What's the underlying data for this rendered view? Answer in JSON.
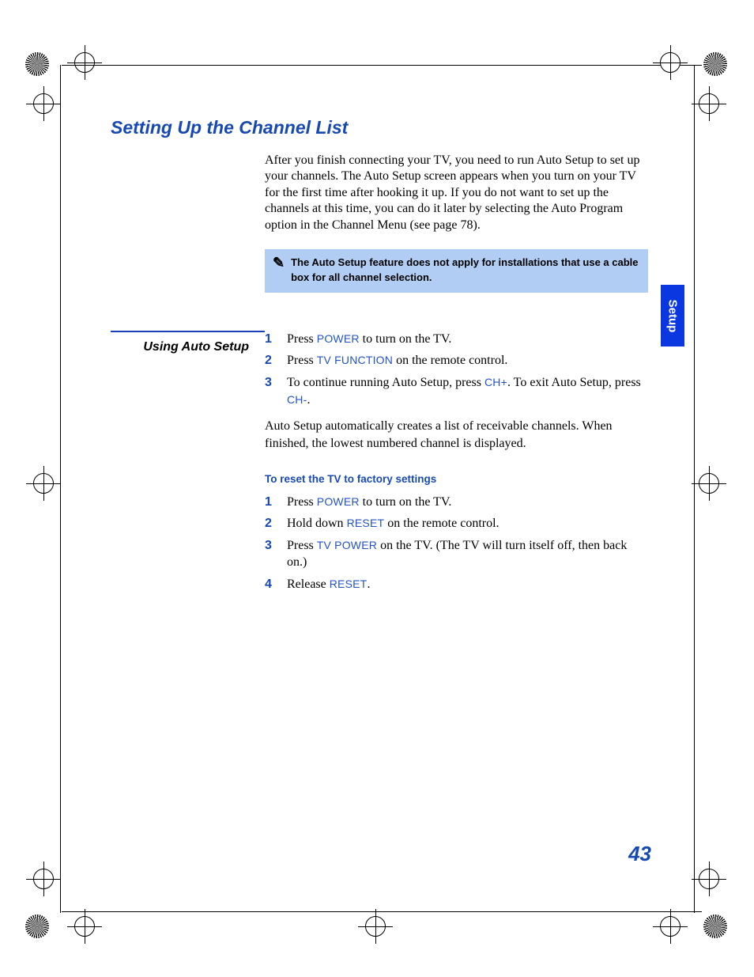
{
  "heading": "Setting Up the Channel List",
  "intro": "After you finish connecting your TV, you need to run Auto Setup to set up your channels. The Auto Setup screen appears when you turn on your TV for the first time after hooking it up. If you do not want to set up the channels at this time, you can do it later by selecting the Auto Program option in the Channel Menu (see page 78).",
  "note": "The Auto Setup feature does not apply for installations that use a cable box for all channel selection.",
  "side_heading": "Using Auto Setup",
  "steps_a": [
    {
      "num": "1",
      "pre": "Press ",
      "key": "POWER",
      "post": " to turn on the TV."
    },
    {
      "num": "2",
      "pre": "Press ",
      "key": "TV FUNCTION",
      "post": " on the remote control."
    },
    {
      "num": "3",
      "pre": "To continue running Auto Setup, press ",
      "key": "CH+",
      "post": ". To exit Auto Setup, press ",
      "key2": "CH-",
      "post2": "."
    }
  ],
  "para_a": "Auto Setup automatically creates a list of receivable channels. When finished, the lowest numbered channel is displayed.",
  "subhead": "To reset the TV to factory settings",
  "steps_b": [
    {
      "num": "1",
      "pre": "Press ",
      "key": "POWER",
      "post": " to turn on the TV."
    },
    {
      "num": "2",
      "pre": "Hold down ",
      "key": "RESET",
      "post": " on the remote control."
    },
    {
      "num": "3",
      "pre": "Press ",
      "key": "TV POWER",
      "post": " on the TV. (The TV will turn itself off, then back on.)"
    },
    {
      "num": "4",
      "pre": "Release ",
      "key": "RESET",
      "post": "."
    }
  ],
  "tab_label": "Setup",
  "page_number": "43"
}
